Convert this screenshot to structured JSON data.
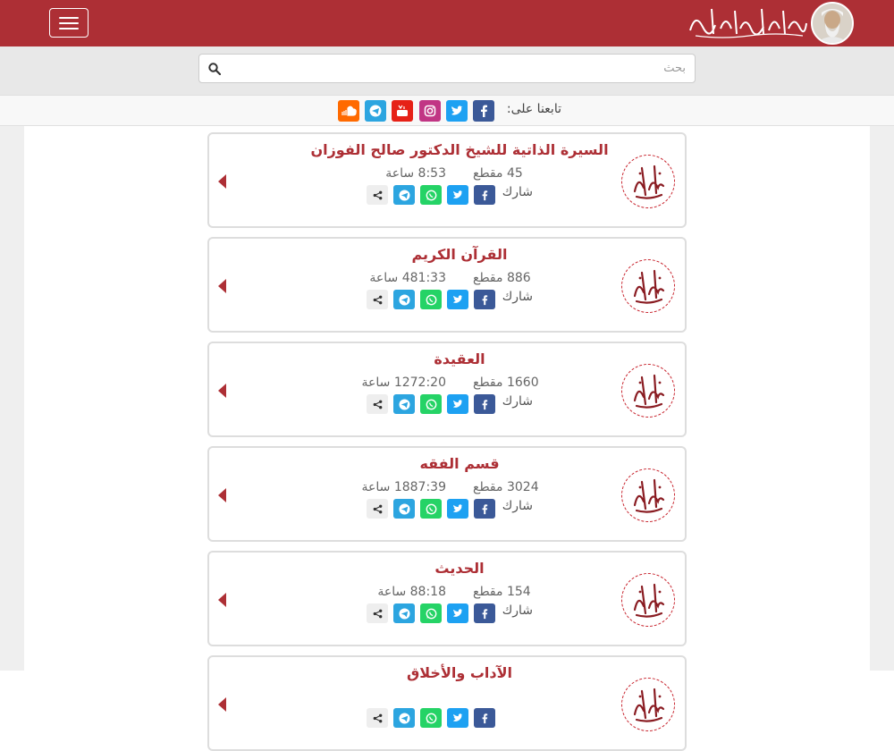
{
  "header": {
    "menu_label": "",
    "brand_colors": {
      "primary": "#ad2f35",
      "white": "#ffffff"
    },
    "logo_icon": "sheikh-avatar-icon",
    "calligraphy_icon": "fawzan-calligraphy-icon"
  },
  "search": {
    "placeholder": "بحث",
    "value": "",
    "icon": "search-icon"
  },
  "follow": {
    "label": "تابعنا على:",
    "networks": [
      {
        "name": "facebook",
        "icon": "facebook-icon",
        "color": "#3b5998"
      },
      {
        "name": "twitter",
        "icon": "twitter-icon",
        "color": "#1da1f2"
      },
      {
        "name": "instagram",
        "icon": "instagram-icon",
        "color": "#c13584"
      },
      {
        "name": "youtube",
        "icon": "youtube-icon",
        "color": "#e62117"
      },
      {
        "name": "telegram",
        "icon": "telegram-icon",
        "color": "#2ca5e0"
      },
      {
        "name": "soundcloud",
        "icon": "soundcloud-icon",
        "color": "#ff6a00"
      }
    ]
  },
  "categories": [
    {
      "title": "السيرة الذاتية للشيخ الدكتور صالح الفوزان",
      "count": "45 مقطع",
      "duration": "8:53 ساعة",
      "share_label": "شارك"
    },
    {
      "title": "القرآن الكريم",
      "count": "886 مقطع",
      "duration": "481:33 ساعة",
      "share_label": "شارك"
    },
    {
      "title": "العقيدة",
      "count": "1660 مقطع",
      "duration": "1272:20 ساعة",
      "share_label": "شارك"
    },
    {
      "title": "قسم الفقه",
      "count": "3024 مقطع",
      "duration": "1887:39 ساعة",
      "share_label": "شارك"
    },
    {
      "title": "الحديث",
      "count": "154 مقطع",
      "duration": "88:18 ساعة",
      "share_label": "شارك"
    },
    {
      "title": "الآداب والأخلاق",
      "count": "",
      "duration": "",
      "share_label": ""
    }
  ],
  "share_buttons": [
    {
      "name": "facebook",
      "icon": "facebook-icon",
      "color": "#3b5998"
    },
    {
      "name": "twitter",
      "icon": "twitter-icon",
      "color": "#1da1f2"
    },
    {
      "name": "whatsapp",
      "icon": "whatsapp-icon",
      "color": "#25d366"
    },
    {
      "name": "telegram",
      "icon": "telegram-icon",
      "color": "#2ca5e0"
    },
    {
      "name": "share",
      "icon": "share-icon",
      "color": "#eeeeee"
    }
  ]
}
